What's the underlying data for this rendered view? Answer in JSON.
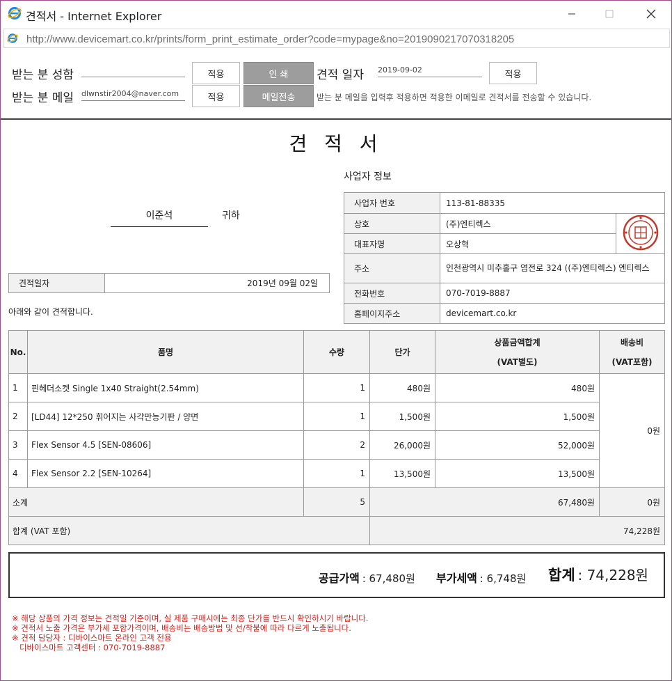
{
  "window": {
    "title": "견적서 - Internet Explorer",
    "url": "http://www.devicemart.co.kr/prints/form_print_estimate_order?code=mypage&no=2019090217070318205"
  },
  "controls": {
    "recipient_name_label": "받는 분 성함",
    "recipient_name_value": "",
    "recipient_email_label": "받는 분 메일",
    "recipient_email_value": "dlwnstir2004@naver.com",
    "apply_label": "적용",
    "print_label": "인 쇄",
    "send_mail_label": "메일전송",
    "estimate_date_label": "견적 일자",
    "estimate_date_value": "2019-09-02",
    "email_note": "받는 분 메일을 입력후 적용하면 적용한 이메일로 견적서를 전송할 수 있습니다."
  },
  "document": {
    "title": "견 적 서",
    "customer_name": "이준석",
    "customer_suffix": "귀하",
    "date_label": "견적일자",
    "date_value": "2019년 09월 02일",
    "intro": "아래와 같이 견적합니다.",
    "business": {
      "heading": "사업자 정보",
      "rows": [
        {
          "label": "사업자 번호",
          "value": "113-81-88335"
        },
        {
          "label": "상호",
          "value": "(주)엔티렉스"
        },
        {
          "label": "대표자명",
          "value": "오상혁"
        },
        {
          "label": "주소",
          "value": "인천광역시 미추홀구 염전로 324 ((주)엔티렉스) 엔티렉스"
        },
        {
          "label": "전화번호",
          "value": "070-7019-8887"
        },
        {
          "label": "홈페이지주소",
          "value": "devicemart.co.kr"
        }
      ]
    },
    "table": {
      "headers": {
        "no": "No.",
        "name": "품명",
        "qty": "수량",
        "unit_price": "단가",
        "amount_line1": "상품금액합계",
        "amount_line2": "(VAT별도)",
        "shipping_line1": "배송비",
        "shipping_line2": "(VAT포함)"
      },
      "rows": [
        {
          "no": "1",
          "name": "핀헤더소켓 Single 1x40 Straight(2.54mm)",
          "qty": "1",
          "unit_price": "480원",
          "amount": "480원"
        },
        {
          "no": "2",
          "name": "[LD44] 12*250 휘어지는 사각만능기판 / 양면",
          "qty": "1",
          "unit_price": "1,500원",
          "amount": "1,500원"
        },
        {
          "no": "3",
          "name": "Flex Sensor 4.5 [SEN-08606]",
          "qty": "2",
          "unit_price": "26,000원",
          "amount": "52,000원"
        },
        {
          "no": "4",
          "name": "Flex Sensor 2.2 [SEN-10264]",
          "qty": "1",
          "unit_price": "13,500원",
          "amount": "13,500원"
        }
      ],
      "shipping": "0원",
      "subtotal_label": "소계",
      "subtotal_qty": "5",
      "subtotal_amount": "67,480원",
      "subtotal_shipping": "0원",
      "total_label": "합계 (VAT 포함)",
      "total_amount": "74,228원"
    },
    "summary": {
      "supply_label": "공급가액",
      "supply_value": ": 67,480원",
      "vat_label": "부가세액",
      "vat_value": ": 6,748원",
      "total_label": "합계",
      "total_value": ": 74,228원"
    },
    "notes": [
      "※ 해당 상품의 가격 정보는 견적일 기준이며, 실 제품 구매시에는 최종 단가를 반드시 확인하시기 바랍니다.",
      "※ 견적서 노출 가격은 부가세 포함가격이며, 배송비는 배송방법 및 선/착불에 따라 다르게 노출됩니다.",
      "※ 견적 담당자 : 디바이스마트 온라인 고객 전용",
      "   디바이스마트 고객센터 : 070-7019-8887"
    ],
    "colors": {
      "note_red": "#c8231e",
      "seal_red": "#c0392b",
      "gray_button": "#9d9d9d",
      "header_gray": "#f1f1f1"
    }
  }
}
